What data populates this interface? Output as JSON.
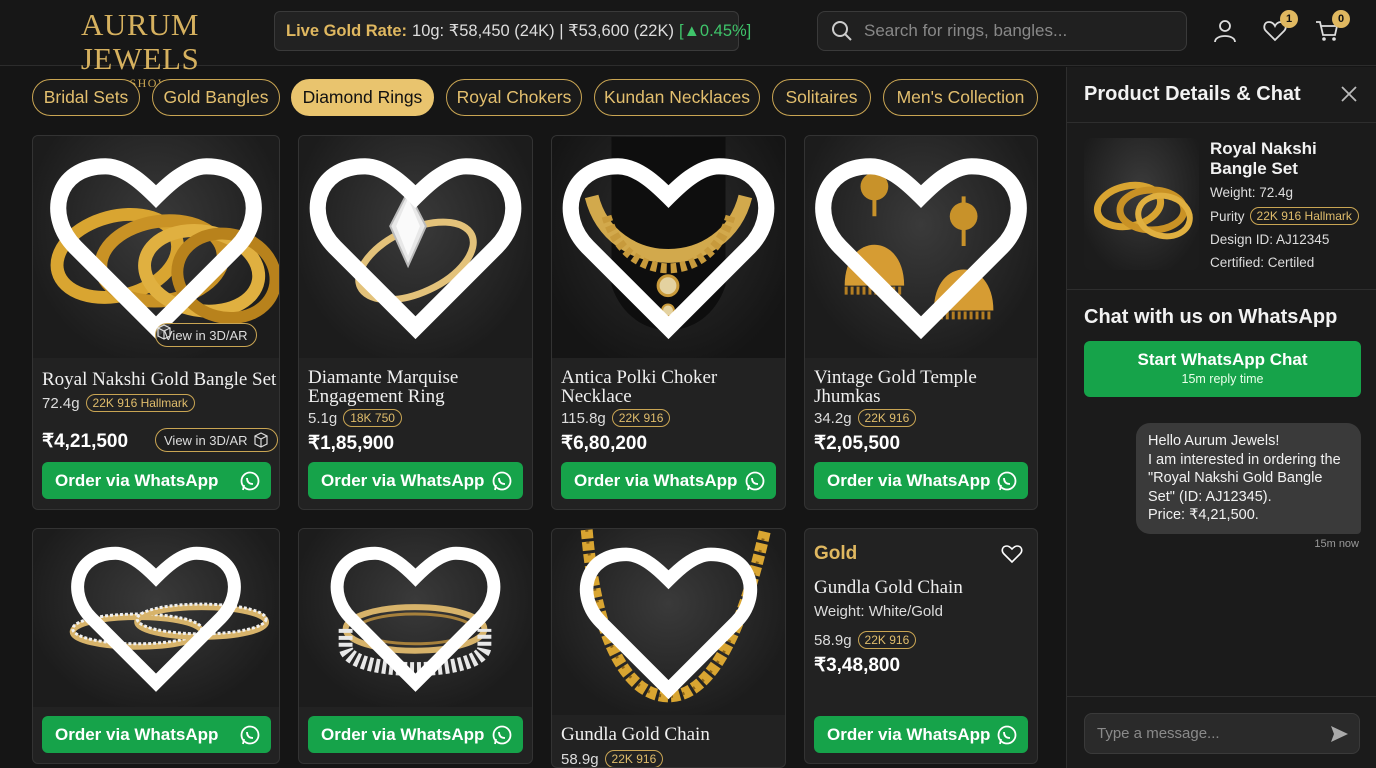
{
  "brand": {
    "name": "AURUM JEWELS",
    "tagline": "DIGITAL SHOWROOM"
  },
  "live_rate": {
    "label": "Live Gold Rate:",
    "text": "10g: ₹58,450 (24K) | ₹53,600 (22K)",
    "change": "[▲0.45%]"
  },
  "search": {
    "placeholder": "Search for rings, bangles..."
  },
  "header_icons": {
    "wishlist_count": "1",
    "cart_count": "0"
  },
  "categories": [
    "Bridal Sets",
    "Gold Bangles",
    "Diamond Rings",
    "Royal Chokers",
    "Kundan Necklaces",
    "Solitaires",
    "Men's Collection"
  ],
  "active_category": "Diamond Rings",
  "ar_label": "View in 3D/AR",
  "order_label": "Order via WhatsApp",
  "products": [
    {
      "title": "Royal Nakshi Gold Bangle Set",
      "weight": "72.4g",
      "purity": "22K 916 Hallmark",
      "price": "₹4,21,500"
    },
    {
      "title1": "Diamante Marquise",
      "title2": "Engagement Ring",
      "weight": "5.1g",
      "purity": "18K 750",
      "price": "₹1,85,900"
    },
    {
      "title1": "Antica Polki Choker",
      "title2": "Necklace",
      "weight": "115.8g",
      "purity": "22K 916",
      "price": "₹6,80,200"
    },
    {
      "title1": "Vintage Gold Temple",
      "title2": "Jhumkas",
      "weight": "34.2g",
      "purity": "22K 916",
      "price": "₹2,05,500"
    },
    {
      "title": "",
      "weight": "",
      "purity": "",
      "price": ""
    },
    {
      "title": "",
      "weight": "",
      "purity": "",
      "price": ""
    },
    {
      "title": "Gundla Gold Chain",
      "weight": "58.9g",
      "purity": "22K 916",
      "price": ""
    },
    {
      "kicker": "Gold",
      "title": "Gundla Gold Chain",
      "subtitle": "Weight: White/Gold",
      "weight": "58.9g",
      "purity": "22K 916",
      "price": "₹3,48,800"
    }
  ],
  "panel": {
    "title": "Product Details & Chat",
    "product_name": "Royal Nakshi Bangle Set",
    "weight": "Weight: 72.4g",
    "purity_label": "Purity",
    "purity": "22K 916 Hallmark",
    "design_id": "Design ID: AJ12345",
    "certified": "Certified: Certiled",
    "chat_title": "Chat with us on WhatsApp",
    "start_chat": "Start WhatsApp Chat",
    "reply_time": "15m reply time",
    "message": "Hello Aurum Jewels!\nI am interested in ordering the \"Royal Nakshi Gold Bangle Set\" (ID: AJ12345).\nPrice: ₹4,21,500.",
    "message_time": "15m now",
    "input_placeholder": "Type a message..."
  },
  "colors": {
    "gold": "#d6b15f",
    "whatsapp_green": "#16a34a",
    "background": "#151515"
  }
}
